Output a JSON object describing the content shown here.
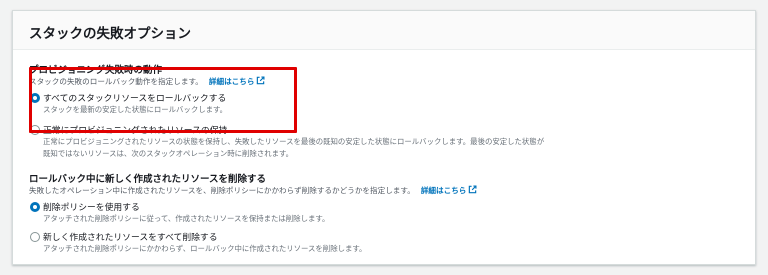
{
  "panel": {
    "title": "スタックの失敗オプション"
  },
  "provisioning": {
    "title": "プロビジョニング失敗時の動作",
    "description": "スタックの失敗のロールバック動作を指定します。",
    "link": "詳細はこちら",
    "options": [
      {
        "label": "すべてのスタックリソースをロールバックする",
        "desc": [
          "スタックを最新の安定した状態にロールバックします。"
        ],
        "selected": true
      },
      {
        "label": "正常にプロビジョニングされたリソースの保持",
        "desc": [
          "正常にプロビジョニングされたリソースの状態を保持し、失敗したリソースを最後の既知の安定した状態にロールバックします。最後の安定した状態が",
          "既知ではないリソースは、次のスタックオペレーション時に削除されます。"
        ],
        "selected": false
      }
    ]
  },
  "delete_new": {
    "title": "ロールバック中に新しく作成されたリソースを削除する",
    "description": "失敗したオペレーション中に作成されたリソースを、削除ポリシーにかかわらず削除するかどうかを指定します。",
    "link": "詳細はこちら",
    "options": [
      {
        "label": "削除ポリシーを使用する",
        "desc": [
          "アタッチされた削除ポリシーに従って、作成されたリソースを保持または削除します。"
        ],
        "selected": true
      },
      {
        "label": "新しく作成されたリソースをすべて削除する",
        "desc": [
          "アタッチされた削除ポリシーにかかわらず、ロールバック中に作成されたリソースを削除します。"
        ],
        "selected": false
      }
    ]
  },
  "colors": {
    "accent": "#0073bb",
    "highlight": "#e00000"
  },
  "icons": {
    "external_link": "external-link-icon"
  }
}
